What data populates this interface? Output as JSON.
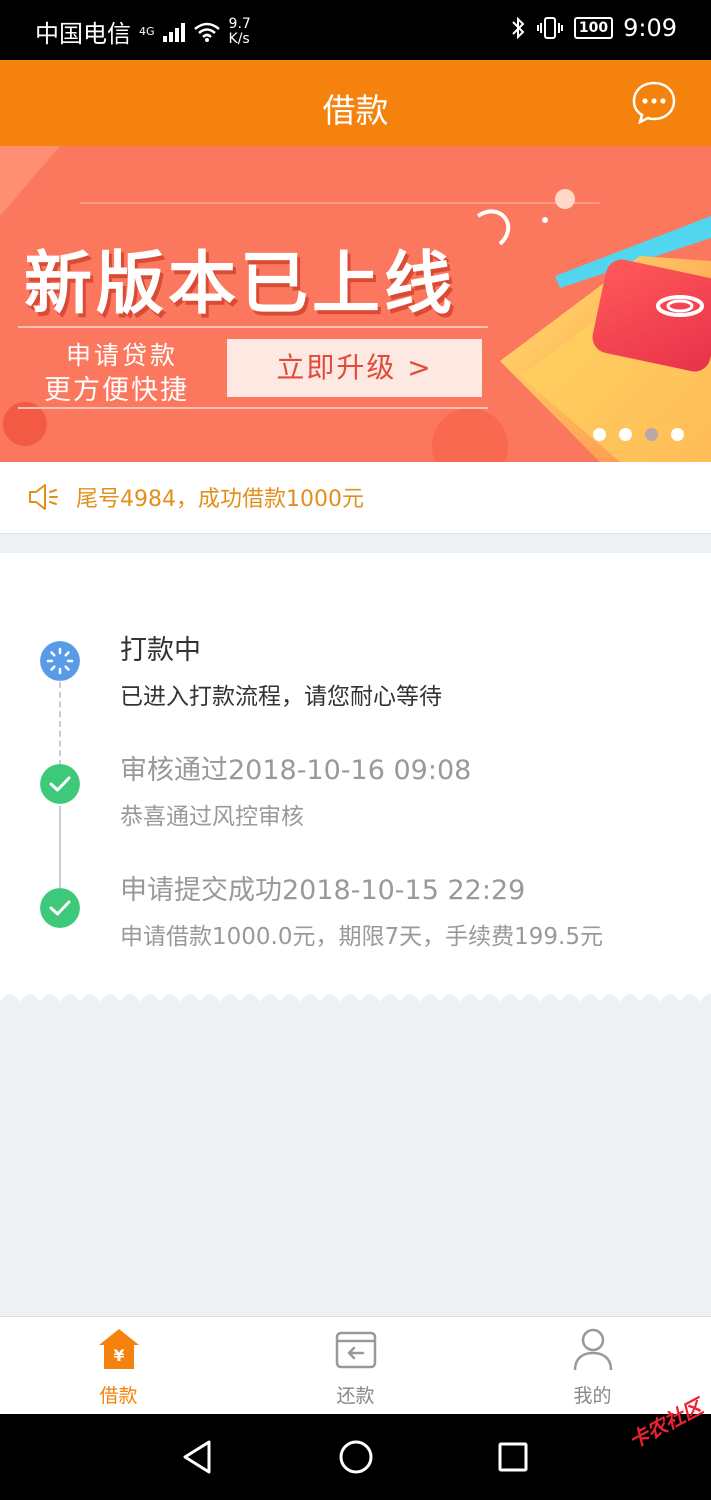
{
  "status_bar": {
    "carrier": "中国电信",
    "network": "4G",
    "speed_value": "9.7",
    "speed_unit": "K/s",
    "battery": "100",
    "time": "9:09"
  },
  "header": {
    "title": "借款",
    "more_icon": "chat-bubble-ellipsis-icon"
  },
  "banner": {
    "headline": "新版本已上线",
    "subline1": "申请贷款",
    "subline2": "更方便快捷",
    "cta_label": "立即升级 >",
    "page_count": 4,
    "active_page": 3
  },
  "notice": {
    "text": "尾号4984，成功借款1000元",
    "icon": "speaker-icon"
  },
  "timeline": [
    {
      "title": "打款中",
      "desc": "已进入打款流程，请您耐心等待",
      "state": "processing"
    },
    {
      "title": "审核通过2018-10-16 09:08",
      "desc": "恭喜通过风控审核",
      "state": "done"
    },
    {
      "title": "申请提交成功2018-10-15 22:29",
      "desc": "申请借款1000.0元，期限7天，手续费199.5元",
      "state": "done"
    }
  ],
  "tabbar": {
    "tabs": [
      {
        "label": "借款",
        "icon": "house-yen-icon",
        "active": true
      },
      {
        "label": "还款",
        "icon": "card-return-icon",
        "active": false
      },
      {
        "label": "我的",
        "icon": "user-icon",
        "active": false
      }
    ]
  },
  "watermark": "卡农社区",
  "colors": {
    "accent": "#f5820c",
    "success": "#3ec97a",
    "processing": "#5a9be8",
    "notice": "#e38f1c"
  }
}
